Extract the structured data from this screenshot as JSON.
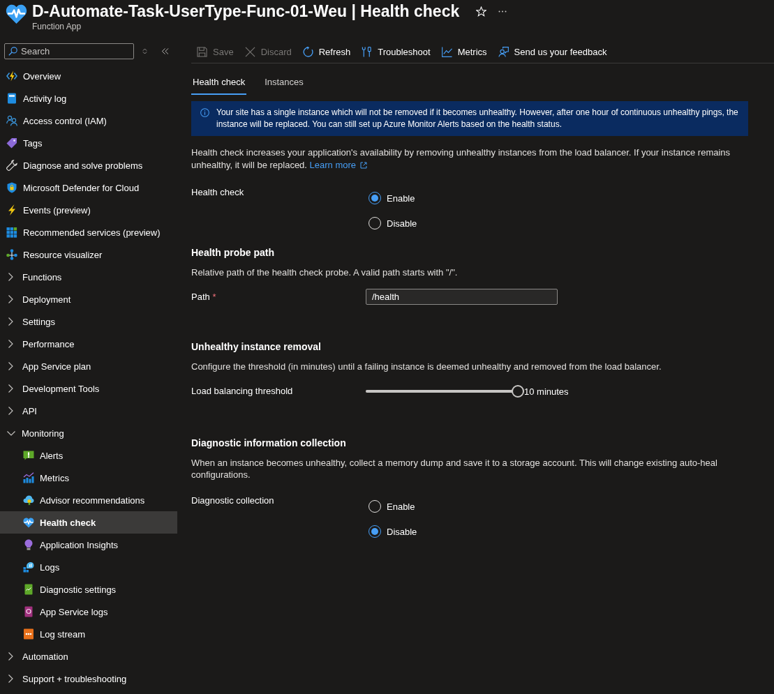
{
  "header": {
    "title": "D-Automate-Task-UserType-Func-01-Weu | Health check",
    "subtitle": "Function App"
  },
  "sidebar": {
    "search": {
      "placeholder": "Search"
    },
    "items": [
      {
        "kind": "link",
        "label": "Overview",
        "selected": false
      },
      {
        "kind": "link",
        "label": "Activity log",
        "selected": false
      },
      {
        "kind": "link",
        "label": "Access control (IAM)",
        "selected": false
      },
      {
        "kind": "link",
        "label": "Tags",
        "selected": false
      },
      {
        "kind": "link",
        "label": "Diagnose and solve problems",
        "selected": false
      },
      {
        "kind": "link",
        "label": "Microsoft Defender for Cloud",
        "selected": false
      },
      {
        "kind": "link",
        "label": "Events (preview)",
        "selected": false
      },
      {
        "kind": "link",
        "label": "Recommended services (preview)",
        "selected": false
      },
      {
        "kind": "link",
        "label": "Resource visualizer",
        "selected": false
      },
      {
        "kind": "group",
        "label": "Functions",
        "expanded": false,
        "selected": false
      },
      {
        "kind": "group",
        "label": "Deployment",
        "expanded": false,
        "selected": false
      },
      {
        "kind": "group",
        "label": "Settings",
        "expanded": false,
        "selected": false
      },
      {
        "kind": "group",
        "label": "Performance",
        "expanded": false,
        "selected": false
      },
      {
        "kind": "group",
        "label": "App Service plan",
        "expanded": false,
        "selected": false
      },
      {
        "kind": "group",
        "label": "Development Tools",
        "expanded": false,
        "selected": false
      },
      {
        "kind": "group",
        "label": "API",
        "expanded": false,
        "selected": false
      },
      {
        "kind": "group",
        "label": "Monitoring",
        "expanded": true,
        "selected": false,
        "children": [
          {
            "kind": "link",
            "label": "Alerts",
            "selected": false
          },
          {
            "kind": "link",
            "label": "Metrics",
            "selected": false
          },
          {
            "kind": "link",
            "label": "Advisor recommendations",
            "selected": false
          },
          {
            "kind": "link",
            "label": "Health check",
            "selected": true
          },
          {
            "kind": "link",
            "label": "Application Insights",
            "selected": false
          },
          {
            "kind": "link",
            "label": "Logs",
            "selected": false
          },
          {
            "kind": "link",
            "label": "Diagnostic settings",
            "selected": false
          },
          {
            "kind": "link",
            "label": "App Service logs",
            "selected": false
          },
          {
            "kind": "link",
            "label": "Log stream",
            "selected": false
          }
        ]
      },
      {
        "kind": "group",
        "label": "Automation",
        "expanded": false,
        "selected": false
      },
      {
        "kind": "group",
        "label": "Support + troubleshooting",
        "expanded": false,
        "selected": false
      }
    ]
  },
  "toolbar": [
    {
      "label": "Save",
      "disabled": true
    },
    {
      "label": "Discard",
      "disabled": true
    },
    {
      "label": "Refresh",
      "disabled": false
    },
    {
      "label": "Troubleshoot",
      "disabled": false
    },
    {
      "label": "Metrics",
      "disabled": false
    },
    {
      "label": "Send us your feedback",
      "disabled": false
    }
  ],
  "tabs": [
    {
      "label": "Health check",
      "selected": true
    },
    {
      "label": "Instances",
      "selected": false
    }
  ],
  "info_banner": "Your site has a single instance which will not be removed if it becomes unhealthy. However, after one hour of continuous unhealthy pings, the instance will be replaced. You can still set up Azure Monitor Alerts based on the health status.",
  "intro": {
    "text": "Health check increases your application's availability by removing unhealthy instances from the load balancer. If your instance remains unhealthy, it will be replaced.",
    "link": "Learn more"
  },
  "health_check": {
    "label": "Health check",
    "options": [
      {
        "label": "Enable",
        "selected": true
      },
      {
        "label": "Disable",
        "selected": false
      }
    ]
  },
  "sections": [
    {
      "kind": "path",
      "heading": "Health probe path",
      "description": "Relative path of the health check probe. A valid path starts with \"/\".",
      "field": {
        "label": "Path",
        "required_mark": "*",
        "value": "/health"
      }
    },
    {
      "kind": "slider",
      "heading": "Unhealthy instance removal",
      "description": "Configure the threshold (in minutes) until a failing instance is deemed unhealthy and removed from the load balancer.",
      "field": {
        "label": "Load balancing threshold",
        "level": 1,
        "reading": "10 minutes"
      }
    },
    {
      "kind": "radio",
      "heading": "Diagnostic information collection",
      "description": "When an instance becomes unhealthy, collect a memory dump and save it to a storage account. This will change existing auto-heal configurations.",
      "field": {
        "label": "Diagnostic collection",
        "options": [
          {
            "label": "Enable",
            "selected": false
          },
          {
            "label": "Disable",
            "selected": true
          }
        ]
      }
    }
  ]
}
